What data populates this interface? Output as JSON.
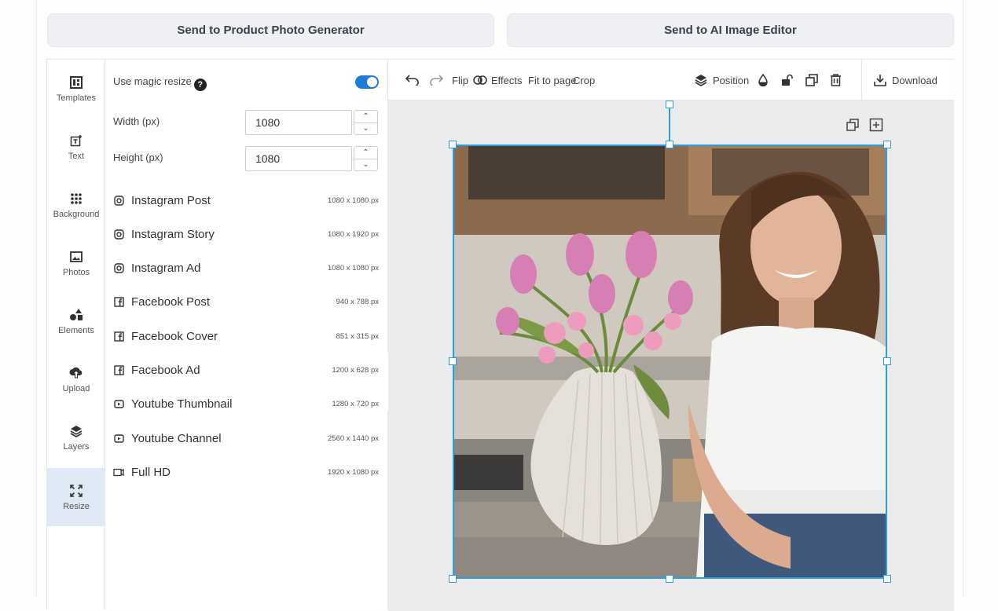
{
  "top_buttons": {
    "product_photo": "Send to Product Photo Generator",
    "ai_editor": "Send to AI Image Editor"
  },
  "sidebar": {
    "items": [
      {
        "label": "Templates",
        "icon": "templates-icon"
      },
      {
        "label": "Text",
        "icon": "text-icon"
      },
      {
        "label": "Background",
        "icon": "background-icon"
      },
      {
        "label": "Photos",
        "icon": "photos-icon"
      },
      {
        "label": "Elements",
        "icon": "elements-icon"
      },
      {
        "label": "Upload",
        "icon": "upload-icon"
      },
      {
        "label": "Layers",
        "icon": "layers-icon"
      },
      {
        "label": "Resize",
        "icon": "resize-icon",
        "active": true
      }
    ]
  },
  "resize_panel": {
    "magic_resize_label": "Use magic resize",
    "help_symbol": "?",
    "magic_resize_on": true,
    "width_label": "Width (px)",
    "width_value": "1080",
    "height_label": "Height (px)",
    "height_value": "1080",
    "presets": [
      {
        "name": "Instagram Post",
        "size": "1080 x 1080 px",
        "icon": "instagram-icon"
      },
      {
        "name": "Instagram Story",
        "size": "1080 x 1920 px",
        "icon": "instagram-icon"
      },
      {
        "name": "Instagram Ad",
        "size": "1080 x 1080 px",
        "icon": "instagram-icon"
      },
      {
        "name": "Facebook Post",
        "size": "940 x 788 px",
        "icon": "facebook-icon"
      },
      {
        "name": "Facebook Cover",
        "size": "851 x 315 px",
        "icon": "facebook-icon"
      },
      {
        "name": "Facebook Ad",
        "size": "1200 x 628 px",
        "icon": "facebook-icon"
      },
      {
        "name": "Youtube Thumbnail",
        "size": "1280 x 720 px",
        "icon": "youtube-icon"
      },
      {
        "name": "Youtube Channel",
        "size": "2560 x 1440 px",
        "icon": "youtube-icon"
      },
      {
        "name": "Full HD",
        "size": "1920 x 1080 px",
        "icon": "video-camera-icon"
      }
    ]
  },
  "toolbar": {
    "flip": "Flip",
    "effects": "Effects",
    "fit_to_page": "Fit to page",
    "crop": "Crop",
    "position": "Position",
    "download": "Download"
  },
  "colors": {
    "accent": "#1e7bd6",
    "selection": "#2a9fdf",
    "active_sidebar": "#dfe9f5"
  }
}
